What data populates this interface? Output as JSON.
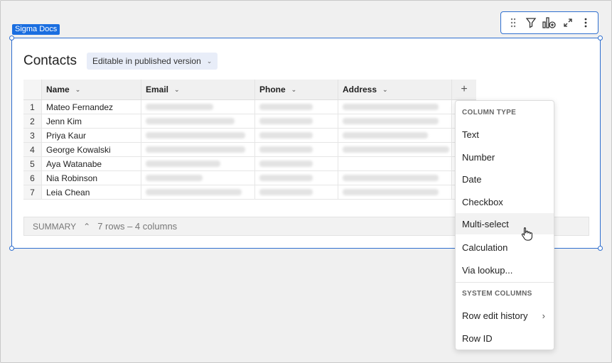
{
  "doc_badge": "Sigma Docs",
  "toolbar": {
    "icons": [
      "drag-handle-icon",
      "filter-icon",
      "chart-add-icon",
      "expand-icon",
      "more-icon"
    ]
  },
  "table": {
    "title": "Contacts",
    "editable_label": "Editable in published version",
    "columns": [
      "Name",
      "Email",
      "Phone",
      "Address"
    ],
    "rows": [
      {
        "index": "1",
        "name": "Mateo Fernandez"
      },
      {
        "index": "2",
        "name": "Jenn Kim"
      },
      {
        "index": "3",
        "name": "Priya Kaur"
      },
      {
        "index": "4",
        "name": "George Kowalski"
      },
      {
        "index": "5",
        "name": "Aya Watanabe"
      },
      {
        "index": "6",
        "name": "Nia Robinson"
      },
      {
        "index": "7",
        "name": "Leia Chean"
      }
    ],
    "add_column_symbol": "+"
  },
  "summary": {
    "label": "SUMMARY",
    "count": "7 rows – 4 columns"
  },
  "menu": {
    "heading_column_type": "COLUMN TYPE",
    "column_types": [
      "Text",
      "Number",
      "Date",
      "Checkbox",
      "Multi-select",
      "Calculation",
      "Via lookup..."
    ],
    "heading_system": "SYSTEM COLUMNS",
    "system_columns": [
      "Row edit history",
      "Row ID"
    ],
    "hovered_item": "Multi-select"
  },
  "colors": {
    "accent": "#2f6fcf",
    "badge": "#1a6ee0"
  }
}
